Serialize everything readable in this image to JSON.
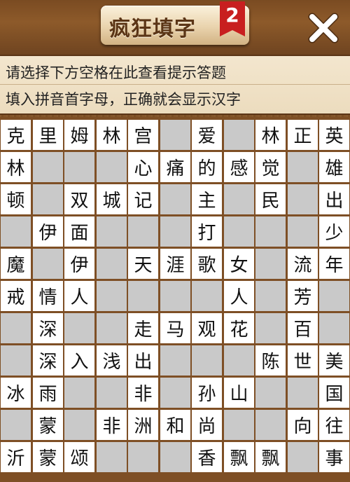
{
  "header": {
    "title": "疯狂填字",
    "badge": "2",
    "close_icon": "close-icon"
  },
  "hints": {
    "line1": "请选择下方空格在此查看提示答题",
    "line2": "填入拼音首字母，正确就会显示汉字"
  },
  "colors": {
    "wood": "#7e4f25",
    "panel": "#f3e6ce",
    "badge": "#c81f1f",
    "white_cell": "#ffffff",
    "gray_cell": "#c9c9c9"
  },
  "grid": [
    [
      "克",
      "里",
      "姆",
      "林",
      "宫",
      "#",
      "爱",
      "#",
      "林",
      "正",
      "英"
    ],
    [
      "林",
      "#",
      "#",
      "#",
      "心",
      "痛",
      "的",
      "感",
      "觉",
      "#",
      "雄"
    ],
    [
      "顿",
      "#",
      "双",
      "城",
      "记",
      "#",
      "主",
      "#",
      "民",
      "#",
      "出"
    ],
    [
      "#",
      "伊",
      "面",
      "#",
      "#",
      "#",
      "打",
      "#",
      "#",
      "#",
      "少"
    ],
    [
      "魔",
      "#",
      "伊",
      "#",
      "天",
      "涯",
      "歌",
      "女",
      "#",
      "流",
      "年"
    ],
    [
      "戒",
      "情",
      "人",
      "#",
      "#",
      "#",
      "#",
      "人",
      "#",
      "芳",
      "#"
    ],
    [
      "#",
      "深",
      "#",
      "#",
      "走",
      "马",
      "观",
      "花",
      "#",
      "百",
      "#"
    ],
    [
      "#",
      "深",
      "入",
      "浅",
      "出",
      "#",
      "#",
      "#",
      "陈",
      "世",
      "美"
    ],
    [
      "冰",
      "雨",
      "#",
      "#",
      "非",
      "#",
      "孙",
      "山",
      "#",
      "#",
      "国"
    ],
    [
      "#",
      "蒙",
      "#",
      "非",
      "洲",
      "和",
      "尚",
      "#",
      "#",
      "向",
      "往"
    ],
    [
      "沂",
      "蒙",
      "颂",
      "#",
      "#",
      "#",
      "香",
      "飘",
      "飘",
      "#",
      "事"
    ]
  ]
}
